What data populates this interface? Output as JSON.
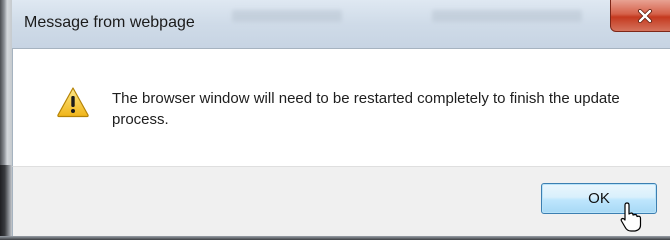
{
  "dialog": {
    "title": "Message from webpage",
    "message": "The browser window will need to be restarted completely to finish the update process.",
    "ok_label": "OK",
    "icon": "warning-icon",
    "close_icon": "close-icon"
  },
  "colors": {
    "titlebar": "#cfdbe8",
    "close_button": "#c4391f",
    "footer": "#f0f0f0",
    "ok_button_border": "#3c7fb1",
    "warning_yellow": "#f6c22a"
  }
}
